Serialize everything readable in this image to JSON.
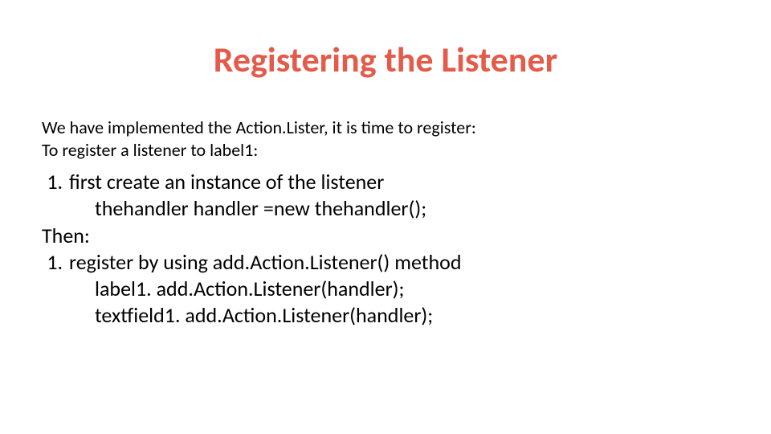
{
  "title": "Registering the Listener",
  "intro_line1": "We have implemented the Action.Lister, it is time to register:",
  "intro_line2": "To register a listener to label1:",
  "step1_text": "first create an instance of the listener",
  "step1_code": "thehandler handler =new thehandler();",
  "then_label": "Then:",
  "step2_text": "register by using add.Action.Listener() method",
  "step2_code1": "label1. add.Action.Listener(handler);",
  "step2_code2": "textfield1. add.Action.Listener(handler);"
}
